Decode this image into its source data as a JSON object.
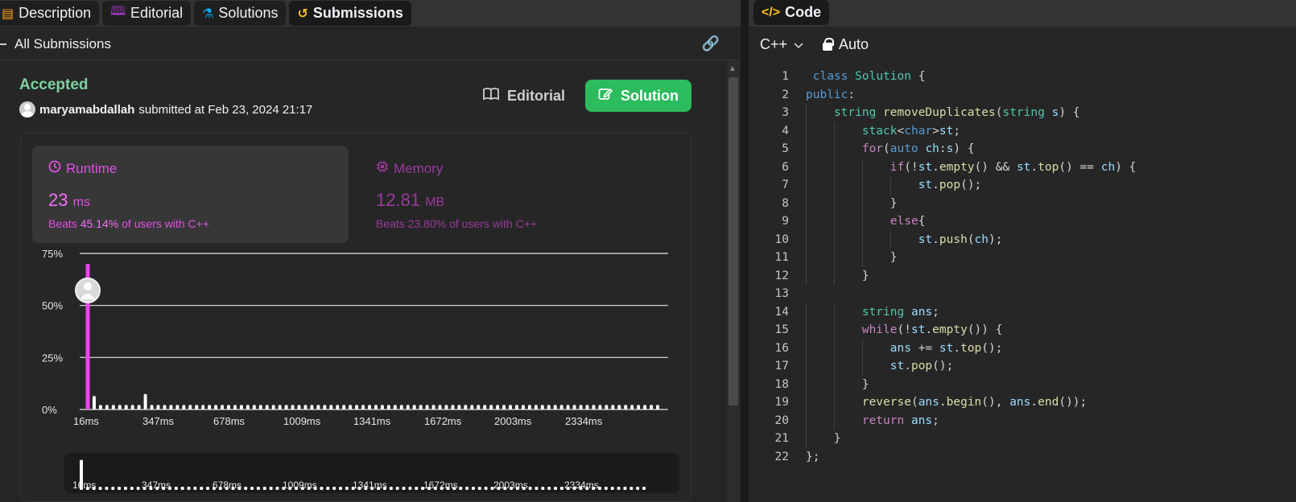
{
  "left_tabs": [
    {
      "label": "Description",
      "icon": "description-icon",
      "color": "#ffa116"
    },
    {
      "label": "Editorial",
      "icon": "book-icon",
      "color": "#a239ca"
    },
    {
      "label": "Solutions",
      "icon": "flask-icon",
      "color": "#0ea5e9"
    },
    {
      "label": "Submissions",
      "icon": "history-icon",
      "color": "#ffc01e"
    }
  ],
  "subheader": {
    "title": "All Submissions",
    "link_icon": "link-icon"
  },
  "submission": {
    "status": "Accepted",
    "user": "maryamabdallah",
    "submitted_text": "submitted at Feb 23, 2024 21:17",
    "editorial_label": "Editorial",
    "solution_label": "Solution"
  },
  "runtime": {
    "label": "Runtime",
    "value": "23",
    "unit": "ms",
    "beats_prefix": "Beats",
    "beats_pct": "45.14%",
    "beats_suffix": "of users with C++"
  },
  "memory": {
    "label": "Memory",
    "value": "12.81",
    "unit": "MB",
    "beats_prefix": "Beats",
    "beats_pct": "23.80%",
    "beats_suffix": "of users with C++"
  },
  "chart_data": {
    "type": "bar",
    "title": "",
    "xlabel": "",
    "ylabel": "",
    "y_ticks": [
      "75%",
      "50%",
      "25%",
      "0%"
    ],
    "x_ticks": [
      "16ms",
      "347ms",
      "678ms",
      "1009ms",
      "1341ms",
      "1672ms",
      "2003ms",
      "2334ms"
    ],
    "ylim": [
      0,
      75
    ],
    "grid": true,
    "highlight_bin_index": 0,
    "values": [
      70,
      6.5,
      2.2,
      2.2,
      2.2,
      2.2,
      2.2,
      2.2,
      2.2,
      7.5,
      2.2,
      2.2,
      2.2,
      2.2,
      2.2,
      2.2,
      2.2,
      2.2,
      2.2,
      2.2,
      2.2,
      2.2,
      2.2,
      2.2,
      2.2,
      2.2,
      2.2,
      2.2,
      2.2,
      2.2,
      2.2,
      2.2,
      2.2,
      2.2,
      2.2,
      2.2,
      2.2,
      2.2,
      2.2,
      2.2,
      2.2,
      2.2,
      2.2,
      2.2,
      2.2,
      2.2,
      2.2,
      2.2,
      2.2,
      2.2,
      2.2,
      2.2,
      2.2,
      2.2,
      2.2,
      2.2,
      2.2,
      2.2,
      2.2,
      2.2,
      2.2,
      2.2,
      2.2,
      2.2,
      2.2,
      2.2,
      2.2,
      2.2,
      2.2,
      2.2,
      2.2,
      2.2,
      2.2,
      2.2,
      2.2,
      2.2,
      2.2,
      2.2,
      2.2,
      2.2,
      2.2,
      2.2,
      2.2,
      2.2,
      2.2,
      2.2,
      2.2,
      2.2,
      2.2,
      2.2
    ],
    "highlight_color": "#f043f2",
    "bar_color": "#ffffff"
  },
  "mini_chart": {
    "x_ticks": [
      "16ms",
      "347ms",
      "678ms",
      "1009ms",
      "1341ms",
      "1672ms",
      "2003ms",
      "2334ms"
    ]
  },
  "code_tab": {
    "label": "Code",
    "icon": "code-icon"
  },
  "editor": {
    "language": "C++",
    "mode": "Auto"
  },
  "code_lines": [
    " class Solution {",
    "public:",
    "    string removeDuplicates(string s) {",
    "        stack<char>st;",
    "        for(auto ch:s) {",
    "            if(!st.empty() && st.top() == ch) {",
    "                st.pop();",
    "            }",
    "            else{",
    "                st.push(ch);",
    "            }",
    "        }",
    "",
    "        string ans;",
    "        while(!st.empty()) {",
    "            ans += st.top();",
    "            st.pop();",
    "        }",
    "        reverse(ans.begin(), ans.end());",
    "        return ans;",
    "    }",
    "};"
  ]
}
